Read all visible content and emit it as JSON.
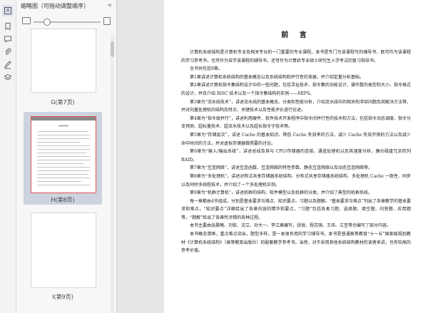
{
  "thumbnail_panel": {
    "title": "缩略图（可拖动调整顺序）",
    "close": "«",
    "thumbnails": [
      {
        "label": "G(第7页)"
      },
      {
        "label": "H(第8页)",
        "selected": true
      },
      {
        "label": "I(第9页)"
      }
    ]
  },
  "document": {
    "title": "前 言",
    "paragraphs": [
      "计算机系统结构是计算机专业及相关专业的一门重要的专业课程。本书是专门为该课程写的辅导书，既可作为该课程的学习参考书，也可作为自学该课程的辅导书，还可作为计算机专业硕士研究生入学考试的复习指导书。",
      "全书共包括9章。",
      "第1章讲述计算机系统结构的基本概念以及系统结构和并行性的发展，并介绍定量分析基础。",
      "第2章讲述计算机指令集结构设计中的一些问题，包括寻址技术、指令集的功能设计、操作数的类型和大小、指令格式的设计，并且介绍 RISC 技术以及一个指令集结构的实例——MIPS。",
      "第3章为“流水线技术”，讲述流水线的基本概念、分类和性能分析，介绍流水线中的相关和冲突问题及其解决方法等，并对向量处理机的结构及特点、关键技术以及性能评价进行论述。",
      "第4章为“指令级并行”，讲述利用硬件、软件技术开发程序中指令间并行性的技术和方法，包括指令动态调度、指令分支预测、超标量技术、超流水技术以及超长指令字技术等。",
      "第5章为“存储层次”，讲述 Cache 的基本知识、降低 Cache 失效率的方法、减少 Cache 失效开销的方法以及减少命中时间的方法，并对虚拟存储器做简要的讨论。",
      "第6章为“输入/输出系统”，讲述总线及其与 CPU/存储器的连接、通道处理机以及其速度分析，廉价磁盘冗余阵列 RAID。",
      "第7章为“互连网络”，讲述互连函数、互连网络的特性参数、静态互连网络以及动态互连网络等。",
      "第8章为“多处理机”，讲述对称式共享存储器系统结构、分布式共享存储器系统结构、多处理机 Cache 一致性、同步以及同时多线程技术，并介绍了一个多处理机实例。",
      "第9章为“机群计算机”，讲述机群的结构、软件模型以及机群的分类，并介绍了典型的机群系统。",
      "每一章都由4节组成，分别是基本要求与难点、知识要点、习题以及题解。“基本要求与难点”列出了各章教学的基本要求和难点，“知识要点”详细给出了各章内容的精华和要点，“习题”包括各类习题、选择题、填空题、问答题、应用题等，“题解”给出了各章所涉猎的各种过程。",
      "本书主要由张晨曦、刘依、沈立、孙大一、李江峰编写，张锐、程志强、王伟、江圣等也编写了部分内容。",
      "本书概念清晰，重点难点突出，题型多样，是一本很有用的学习辅导书。本书是普通高等教育“十一五”国家级规划教材《计算机系统结构》（高等教育出版社）的配套教学参考书。当然，对于采用其他系统结构教材的读者来说，也有较高的参考价值。"
    ]
  },
  "colors": {
    "panel_bg": "#f7f7f7",
    "selected_bg": "#ccd3df",
    "selected_border": "#e05050",
    "page_bg": "#ffffff",
    "doc_bg": "#e6e6e6"
  }
}
